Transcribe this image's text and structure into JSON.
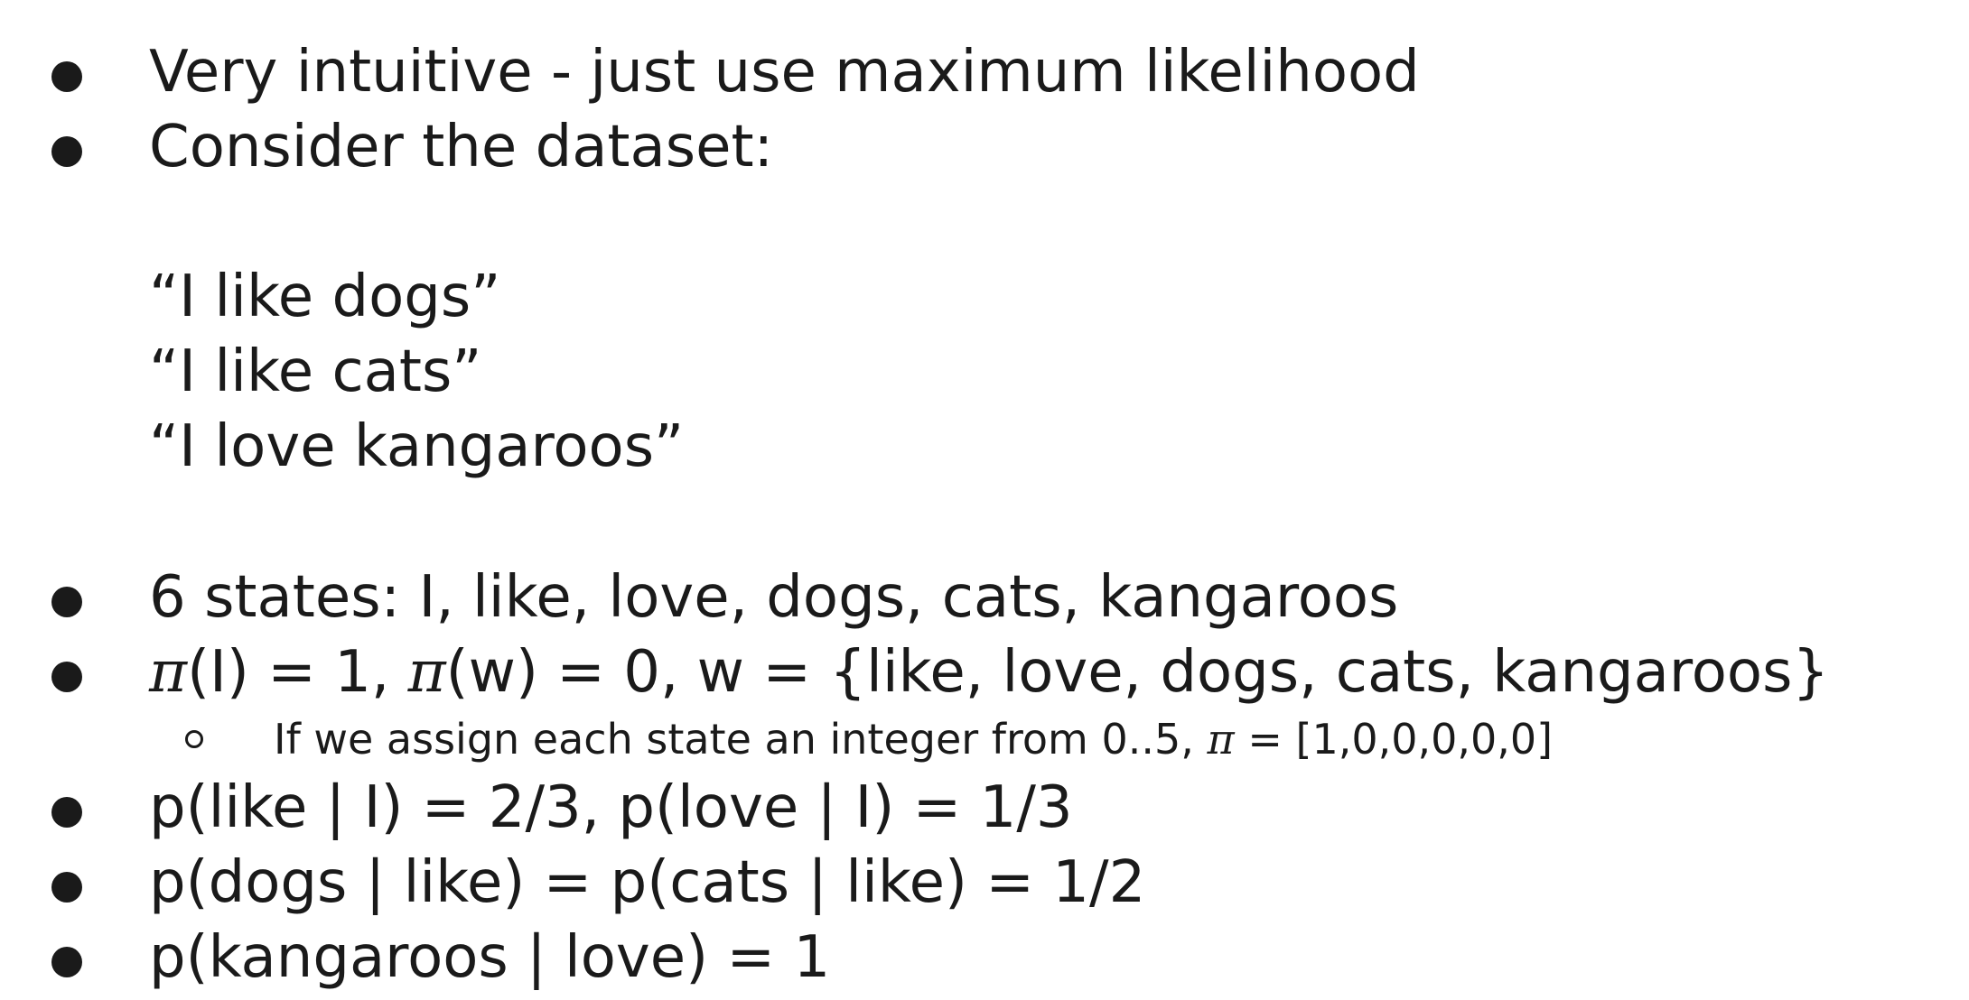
{
  "bullets": {
    "b1": "Very intuitive - just use maximum likelihood",
    "b2": "Consider the dataset:",
    "dataset": [
      "“I like dogs”",
      "“I like cats”",
      "“I love kangaroos”"
    ],
    "b3": "6 states: I, like, love, dogs, cats, kangaroos",
    "b4": {
      "pi": "π",
      "part1": "(I) = 1, ",
      "part2": "(w) = 0, w = {like, love, dogs, cats, kangaroos}"
    },
    "b4_sub": {
      "part1": "If we assign each state an integer from 0..5, ",
      "pi": "π",
      "part2": " = [1,0,0,0,0,0]"
    },
    "b5": "p(like | I) = 2/3, p(love | I) = 1/3",
    "b6": "p(dogs | like) = p(cats | like) = 1/2",
    "b7": "p(kangaroos | love) = 1"
  }
}
